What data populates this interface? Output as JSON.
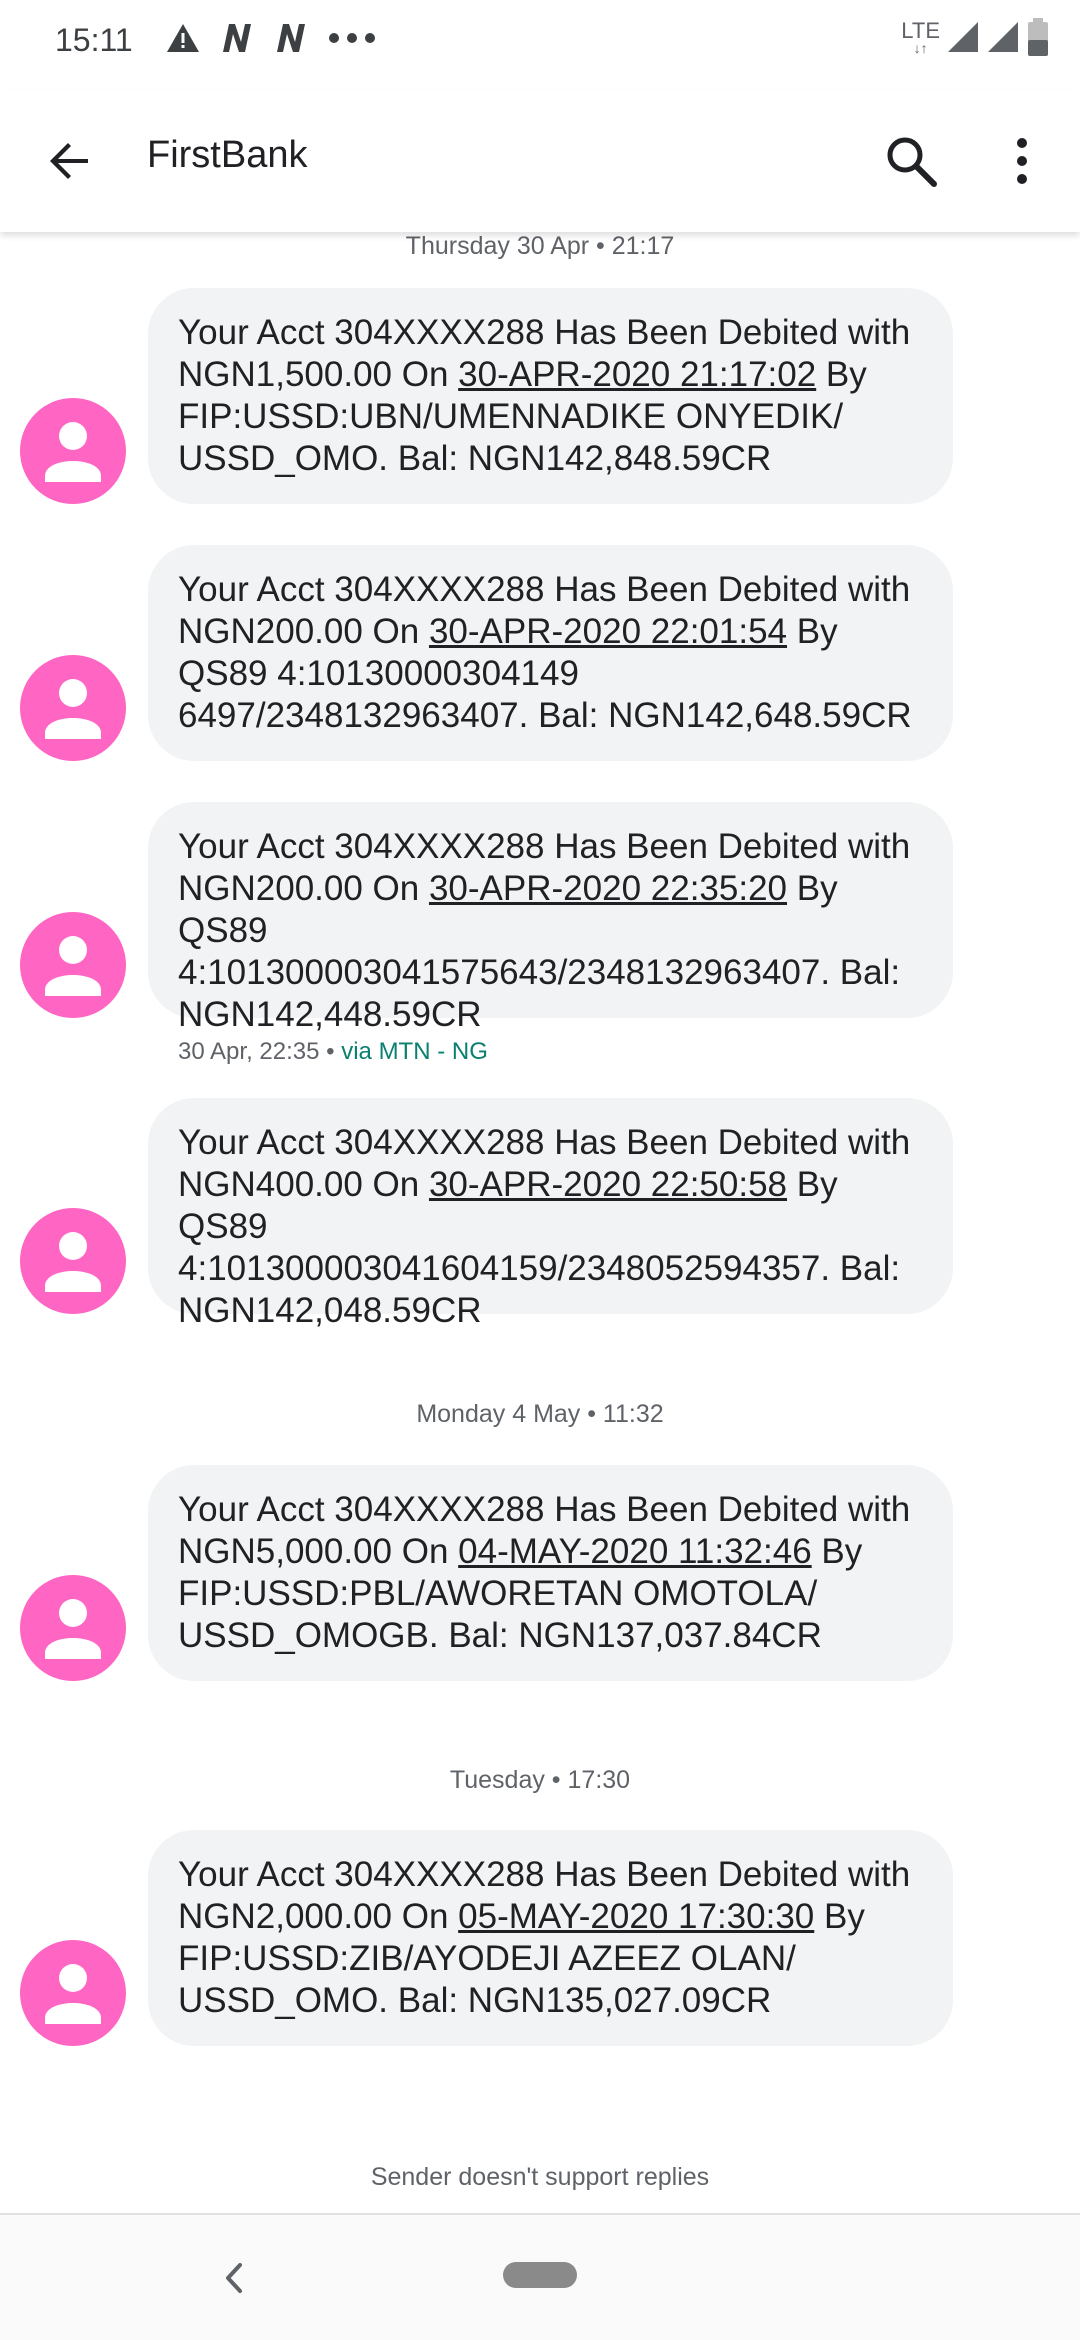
{
  "status_bar": {
    "time": "15:11",
    "network": "LTE"
  },
  "header": {
    "title": "FirstBank"
  },
  "thread": [
    {
      "type": "date",
      "text": "Thursday 30 Apr • 21:17"
    },
    {
      "type": "message",
      "pre": "Your Acct 304XXXX288 Has Been Debited with NGN1,500.00 On ",
      "link": "30-APR-2020 21:17:02",
      "post": " By FIP:USSD:UBN/UMENNADIKE ONYEDIK/ USSD_OMO. Bal: NGN142,848.59CR"
    },
    {
      "type": "message",
      "pre": "Your Acct 304XXXX288 Has Been Debited with NGN200.00 On ",
      "link": "30-APR-2020 22:01:54",
      "post": " By QS89 4:10130000304149 6497/2348132963407. Bal: NGN142,648.59CR"
    },
    {
      "type": "message",
      "pre": "Your Acct 304XXXX288 Has Been Debited with NGN200.00 On ",
      "link": "30-APR-2020 22:35:20",
      "post": " By QS89 4:101300003041575643/2348132963407. Bal: NGN142,448.59CR",
      "meta_time": "30 Apr, 22:35",
      "meta_via": "via MTN - NG"
    },
    {
      "type": "message",
      "pre": "Your Acct 304XXXX288 Has Been Debited with NGN400.00 On ",
      "link": "30-APR-2020 22:50:58",
      "post": " By QS89 4:101300003041604159/2348052594357. Bal: NGN142,048.59CR"
    },
    {
      "type": "date",
      "text": "Monday 4 May • 11:32"
    },
    {
      "type": "message",
      "pre": "Your Acct 304XXXX288 Has Been Debited with NGN5,000.00 On ",
      "link": "04-MAY-2020 11:32:46",
      "post": " By FIP:USSD:PBL/AWORETAN OMOTOLA/ USSD_OMOGB. Bal: NGN137,037.84CR"
    },
    {
      "type": "date",
      "text": "Tuesday • 17:30"
    },
    {
      "type": "message",
      "pre": "Your Acct 304XXXX288 Has Been Debited with NGN2,000.00 On ",
      "link": "05-MAY-2020 17:30:30",
      "post": " By FIP:USSD:ZIB/AYODEJI AZEEZ OLAN/ USSD_OMO. Bal: NGN135,027.09CR"
    }
  ],
  "footer": {
    "no_reply_text": "Sender doesn't support replies"
  },
  "colors": {
    "avatar": "#ff66c4",
    "bubble": "#f1f3f4",
    "via": "#0b7f70"
  },
  "icons": {
    "back": "arrow-left-icon",
    "search": "search-icon",
    "more": "more-vert-icon",
    "avatar": "person-icon"
  }
}
